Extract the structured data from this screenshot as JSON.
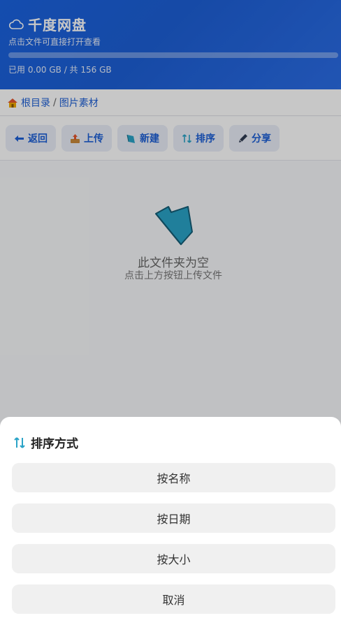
{
  "header": {
    "app_name": "千度网盘",
    "subtitle": "点击文件可直接打开查看",
    "usage_text": "已用 0.00 GB / 共 156 GB",
    "usage_fraction": 0.0
  },
  "breadcrumb": {
    "root": "根目录",
    "separator": "/",
    "current": "图片素材"
  },
  "toolbar": {
    "back": "返回",
    "upload": "上传",
    "new": "新建",
    "sort": "排序",
    "share": "分享"
  },
  "empty_state": {
    "title": "此文件夹为空",
    "hint": "点击上方按钮上传文件"
  },
  "sort_sheet": {
    "title": "排序方式",
    "options": [
      "按名称",
      "按日期",
      "按大小"
    ],
    "cancel": "取消"
  },
  "colors": {
    "brand_blue": "#1d5fd6",
    "accent_teal": "#2aa3c7"
  }
}
